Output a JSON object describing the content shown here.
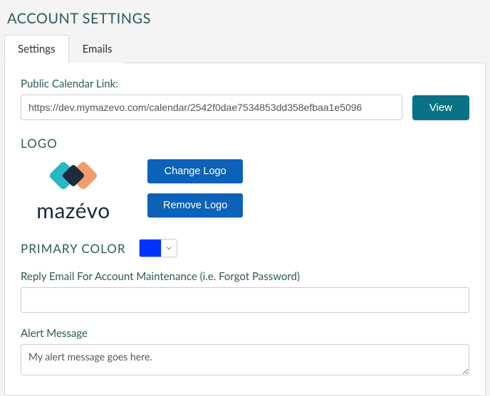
{
  "page": {
    "title": "ACCOUNT SETTINGS"
  },
  "tabs": {
    "settings": "Settings",
    "emails": "Emails"
  },
  "publicCalendar": {
    "label": "Public Calendar Link:",
    "value": "https://dev.mymazevo.com/calendar/2542f0dae7534853dd358efbaa1e5096",
    "viewBtn": "View"
  },
  "logo": {
    "heading": "LOGO",
    "wordmark": "mazévo",
    "changeBtn": "Change Logo",
    "removeBtn": "Remove Logo"
  },
  "primaryColor": {
    "heading": "PRIMARY COLOR",
    "value": "#0033ff"
  },
  "replyEmail": {
    "label": "Reply Email For Account Maintenance (i.e. Forgot Password)",
    "value": ""
  },
  "alert": {
    "label": "Alert Message",
    "value": "My alert message goes here."
  }
}
